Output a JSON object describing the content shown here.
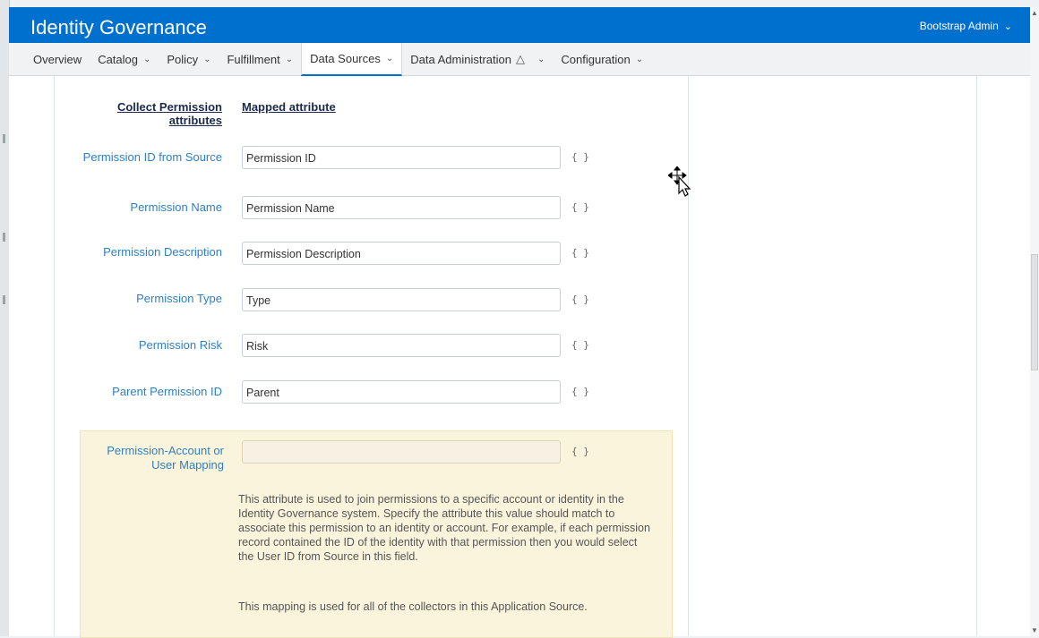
{
  "header": {
    "title": "Identity Governance",
    "user": "Bootstrap Admin"
  },
  "nav": [
    {
      "label": "Overview",
      "chevron": false,
      "warning": false,
      "active": false
    },
    {
      "label": "Catalog",
      "chevron": true,
      "warning": false,
      "active": false
    },
    {
      "label": "Policy",
      "chevron": true,
      "warning": false,
      "active": false
    },
    {
      "label": "Fulfillment",
      "chevron": true,
      "warning": false,
      "active": false
    },
    {
      "label": "Data Sources",
      "chevron": true,
      "warning": false,
      "active": true
    },
    {
      "label": "Data Administration",
      "chevron": true,
      "warning": true,
      "active": false
    },
    {
      "label": "Configuration",
      "chevron": true,
      "warning": false,
      "active": false
    }
  ],
  "form": {
    "col_header_left": "Collect Permission attributes",
    "col_header_right": "Mapped attribute",
    "brace_label": "{ }",
    "fields": [
      {
        "label": "Permission ID from Source",
        "value": "Permission ID"
      },
      {
        "label": "Permission Name",
        "value": "Permission Name"
      },
      {
        "label": "Permission Description",
        "value": "Permission Description"
      },
      {
        "label": "Permission Type",
        "value": "Type"
      },
      {
        "label": "Permission Risk",
        "value": "Risk"
      },
      {
        "label": "Parent Permission ID",
        "value": "Parent"
      }
    ],
    "mapping": {
      "label": "Permission-Account or User Mapping",
      "value": "",
      "help1": "This attribute is used to join permissions to a specific account or identity in the Identity Governance system. Specify the attribute this value should match to associate this permission to an identity or account. For example, if each permission record contained the ID of the identity with that permission then you would select the User ID from Source in this field.",
      "help2": "This mapping is used for all of the collectors in this Application Source."
    }
  },
  "icons": {
    "chevron": "chevron-down-icon",
    "warning": "warning-triangle-icon",
    "cursor": "move-cursor-icon"
  },
  "colors": {
    "header": "#0070cf",
    "label": "#2f7fc1",
    "mapping_bg": "#fbf4dd"
  }
}
